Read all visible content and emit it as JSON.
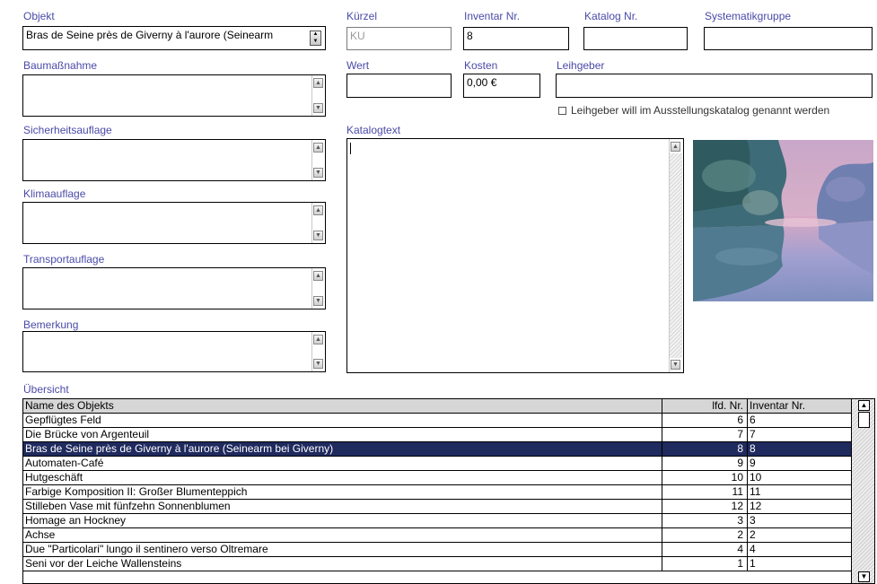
{
  "labels": {
    "objekt": "Objekt",
    "kuerzel": "Kürzel",
    "inventar_nr": "Inventar Nr.",
    "katalog_nr": "Katalog Nr.",
    "systematikgruppe": "Systematikgruppe",
    "baumassnahme": "Baumaßnahme",
    "wert": "Wert",
    "kosten": "Kosten",
    "leihgeber": "Leihgeber",
    "sicherheitsauflage": "Sicherheitsauflage",
    "katalogtext": "Katalogtext",
    "klimaauflage": "Klimaauflage",
    "transportauflage": "Transportauflage",
    "bemerkung": "Bemerkung",
    "uebersicht": "Übersicht",
    "leihgeber_checkbox": "Leihgeber will im Ausstellungskatalog genannt werden"
  },
  "values": {
    "objekt": "Bras de Seine près de Giverny à l'aurore (Seinearm",
    "kuerzel": "KU",
    "inventar_nr": "8",
    "katalog_nr": "",
    "systematikgruppe": "",
    "baumassnahme": "",
    "wert": "",
    "kosten": "0,00 €",
    "leihgeber": "",
    "sicherheitsauflage": "",
    "katalogtext": "",
    "klimaauflage": "",
    "transportauflage": "",
    "bemerkung": "",
    "leihgeber_checkbox_checked": false
  },
  "table": {
    "headers": {
      "name": "Name des Objekts",
      "lfd": "lfd. Nr.",
      "inventar": "Inventar Nr."
    },
    "selected_index": 2,
    "rows": [
      {
        "name": "Gepflügtes Feld",
        "lfd": "6",
        "inventar": "6"
      },
      {
        "name": "Die Brücke von Argenteuil",
        "lfd": "7",
        "inventar": "7"
      },
      {
        "name": "Bras de Seine près de Giverny à l'aurore (Seinearm bei Giverny)",
        "lfd": "8",
        "inventar": "8"
      },
      {
        "name": "Automaten-Café",
        "lfd": "9",
        "inventar": "9"
      },
      {
        "name": "Hutgeschäft",
        "lfd": "10",
        "inventar": "10"
      },
      {
        "name": "Farbige Komposition II: Großer Blumenteppich",
        "lfd": "11",
        "inventar": "11"
      },
      {
        "name": "Stilleben Vase mit fünfzehn Sonnenblumen",
        "lfd": "12",
        "inventar": "12"
      },
      {
        "name": "Homage an Hockney",
        "lfd": "3",
        "inventar": "3"
      },
      {
        "name": "Achse",
        "lfd": "2",
        "inventar": "2"
      },
      {
        "name": "Due \"Particolari\" lungo il sentinero verso Oltremare",
        "lfd": "4",
        "inventar": "4"
      },
      {
        "name": "Seni vor der Leiche Wallensteins",
        "lfd": "1",
        "inventar": "1"
      }
    ]
  },
  "colors": {
    "label": "#4a4aa8",
    "selection": "#1f2a5e"
  },
  "icons": {
    "scroll_up": "arrow-up-icon",
    "scroll_down": "arrow-down-icon"
  }
}
